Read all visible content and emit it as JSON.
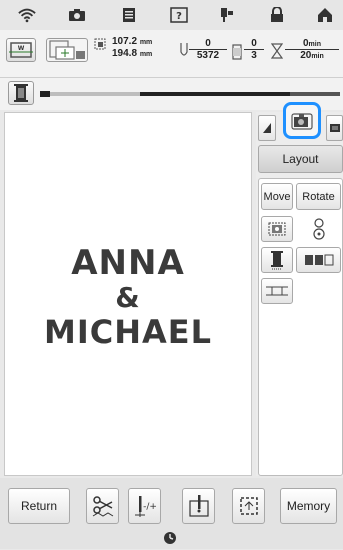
{
  "status": {
    "size_width": "107.2",
    "size_height": "194.8",
    "size_unit": "mm",
    "stitch_current": "0",
    "stitch_total": "5372",
    "color_current": "0",
    "color_total": "3",
    "time_current": "0",
    "time_total": "20",
    "time_unit": "min"
  },
  "canvas": {
    "line1": "ANNA",
    "line2": "&",
    "line3": "MICHAEL"
  },
  "panel": {
    "layout_label": "Layout",
    "move_label": "Move",
    "rotate_label": "Rotate"
  },
  "bottom": {
    "return_label": "Return",
    "memory_label": "Memory"
  },
  "colors": {
    "highlight": "#1e90ff"
  }
}
